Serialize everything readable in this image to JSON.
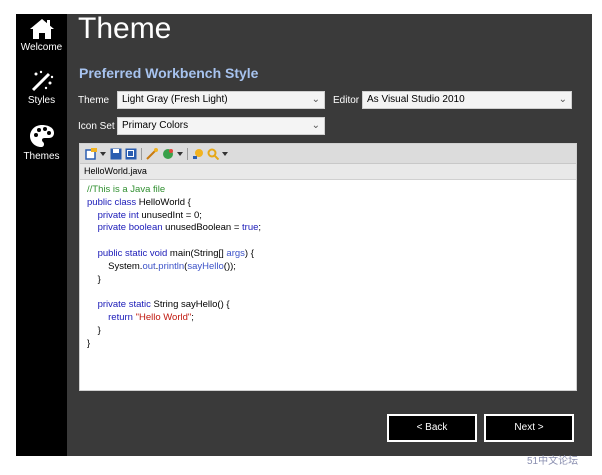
{
  "nav": {
    "items": [
      {
        "label": "Welcome",
        "icon": "home-icon"
      },
      {
        "label": "Styles",
        "icon": "magic-wand-icon"
      },
      {
        "label": "Themes",
        "icon": "palette-icon"
      }
    ]
  },
  "page": {
    "title": "Theme",
    "subtitle": "Preferred Workbench Style"
  },
  "form": {
    "theme_label": "Theme",
    "theme_value": "Light Gray (Fresh Light)",
    "editor_label": "Editor",
    "editor_value": "As Visual Studio 2010",
    "iconset_label": "Icon Set",
    "iconset_value": "Primary Colors"
  },
  "editor": {
    "tab_label": "HelloWorld.java",
    "code": {
      "l1": "//This is a Java file",
      "l2_kw": "public class",
      "l2_rest": " HelloWorld {",
      "l3_kw": "private int",
      "l3_rest": " unusedInt = 0;",
      "l4_kw": "private boolean",
      "l4_mid": " unusedBoolean = ",
      "l4_val": "true",
      "l4_end": ";",
      "l5_kw": "public static void",
      "l5_rest": " main(String[] ",
      "l5_arg": "args",
      "l5_end": ") {",
      "l6_a": "System.",
      "l6_b": "out",
      "l6_c": ".",
      "l6_d": "println",
      "l6_e": "(",
      "l6_f": "sayHello",
      "l6_g": "());",
      "l7": "}",
      "l8_kw": "private static",
      "l8_rest": " String sayHello() {",
      "l9_kw": "return",
      "l9_str": "\"Hello World\"",
      "l9_end": ";",
      "l10": "}",
      "l11": "}"
    }
  },
  "buttons": {
    "back": "< Back",
    "next": "Next >"
  },
  "watermark": "51中文论坛",
  "colors": {
    "subtitle": "#a7c3ef",
    "background": "#3a3a3a",
    "nav": "#000000"
  }
}
